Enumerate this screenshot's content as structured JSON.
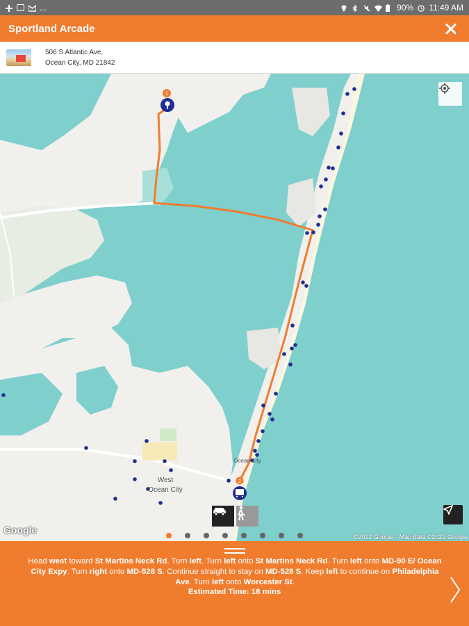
{
  "status_bar": {
    "battery": "90%",
    "time": "11:49 AM",
    "dots": "..."
  },
  "header": {
    "title": "Sportland Arcade",
    "close_icon": "close-icon"
  },
  "address": {
    "line1": "506 S Atlantic Ave,",
    "line2": "Ocean City, MD 21842"
  },
  "map": {
    "labels": {
      "west_ocean_city_1": "West",
      "west_ocean_city_2": "Ocean City",
      "ocean_city": "Ocean City"
    },
    "google": "Google",
    "copyright": "©2022 Google · Map data ©2022 Google",
    "start_marker": "1",
    "end_marker": "2",
    "route_color": "#f07c2e",
    "stop_color": "#1f2f8f",
    "water_color": "#7fcfcd"
  },
  "travel_modes": [
    "car-icon",
    "walk-icon"
  ],
  "pagination": {
    "count": 8,
    "active": 0
  },
  "directions": {
    "segments": [
      {
        "t": "Head ",
        "b": false
      },
      {
        "t": "west",
        "b": true
      },
      {
        "t": " toward ",
        "b": false
      },
      {
        "t": "St Martins Neck Rd",
        "b": true
      },
      {
        "t": ". Turn ",
        "b": false
      },
      {
        "t": "left",
        "b": true
      },
      {
        "t": ". Turn ",
        "b": false
      },
      {
        "t": "left",
        "b": true
      },
      {
        "t": " onto ",
        "b": false
      },
      {
        "t": "St Martins Neck Rd",
        "b": true
      },
      {
        "t": ". Turn ",
        "b": false
      },
      {
        "t": "left",
        "b": true
      },
      {
        "t": " onto ",
        "b": false
      },
      {
        "t": "MD-90 E/ Ocean City Expy",
        "b": true
      },
      {
        "t": ". Turn ",
        "b": false
      },
      {
        "t": "right",
        "b": true
      },
      {
        "t": " onto ",
        "b": false
      },
      {
        "t": "MD-528 S",
        "b": true
      },
      {
        "t": ". Continue straight to stay on ",
        "b": false
      },
      {
        "t": "MD-528 S",
        "b": true
      },
      {
        "t": ". Keep ",
        "b": false
      },
      {
        "t": "left",
        "b": true
      },
      {
        "t": " to continue on ",
        "b": false
      },
      {
        "t": "Philadelphia Ave",
        "b": true
      },
      {
        "t": ". Turn ",
        "b": false
      },
      {
        "t": "left",
        "b": true
      },
      {
        "t": " onto ",
        "b": false
      },
      {
        "t": "Worcester St",
        "b": true
      },
      {
        "t": ".",
        "b": false
      }
    ],
    "estimated_time": "Estimated Time: 18 mins"
  }
}
